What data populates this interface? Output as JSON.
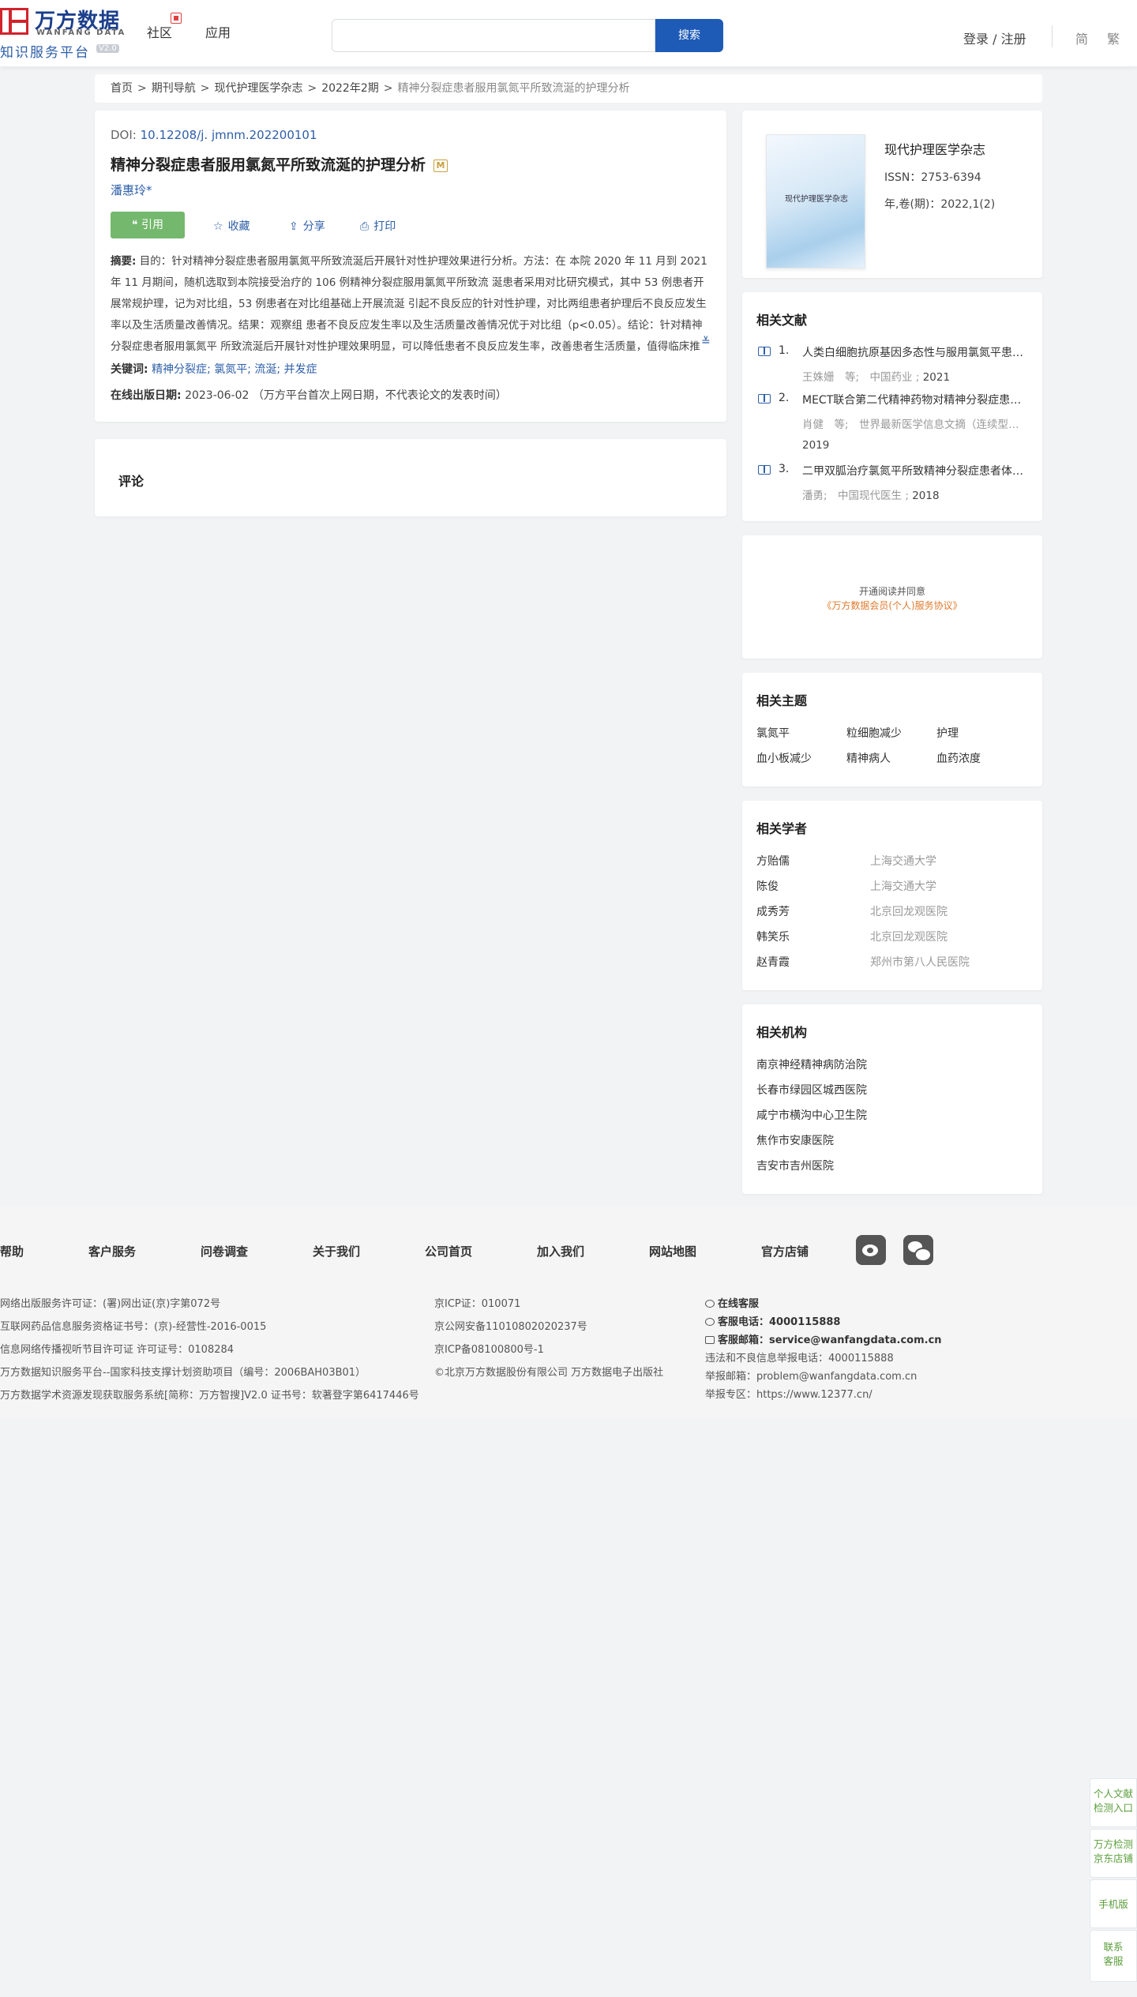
{
  "header": {
    "logo_cn": "万方数据",
    "logo_en": "WANFANG DATA",
    "logo_sub": "知识服务平台",
    "logo_ver": "V2.0",
    "nav": [
      "社区",
      "应用"
    ],
    "search_placeholder": "",
    "search_button": "搜索",
    "login": "登录 / 注册",
    "lang_simplified": "简",
    "lang_traditional": "繁"
  },
  "breadcrumb": [
    "首页",
    "期刊导航",
    "现代护理医学杂志",
    "2022年2期",
    "精神分裂症患者服用氯氮平所致流涎的护理分析"
  ],
  "article": {
    "doi_label": "DOI:",
    "doi": "10.12208/j. jmnm.202200101",
    "title": "精神分裂症患者服用氯氮平所致流涎的护理分析",
    "m_badge": "M",
    "author": "潘惠玲*",
    "actions": {
      "cite": "引用",
      "favorite": "收藏",
      "share": "分享",
      "print": "打印"
    },
    "abstract_label": "摘要:",
    "abstract": "目的：针对精神分裂症患者服用氯氮平所致流涎后开展针对性护理效果进行分析。方法：在 本院 2020 年 11 月到 2021 年 11 月期间，随机选取到本院接受治疗的 106 例精神分裂症服用氯氮平所致流 涎患者采用对比研究模式，其中 53 例患者开展常规护理，记为对比组，53 例患者在对比组基础上开展流涎 引起不良反应的针对性护理，对比两组患者护理后不良反应发生率以及生活质量改善情况。结果：观察组 患者不良反应发生率以及生活质量改善情况优于对比组（p<0.05）。结论：针对精神分裂症患者服用氯氮平 所致流涎后开展针对性护理效果明显，可以降低患者不良反应发生率，改善患者生活质量，值得临床推广。",
    "keywords_label": "关键词:",
    "keywords": [
      "精神分裂症",
      "氯氮平",
      "流涎",
      "并发症"
    ],
    "pubdate_label": "在线出版日期:",
    "pubdate": "2023-06-02",
    "pubdate_note": "（万方平台首次上网日期，不代表论文的发表时间）"
  },
  "comments": {
    "title": "评论"
  },
  "journal": {
    "cover_text": "现代护理医学杂志",
    "name": "现代护理医学杂志",
    "issn": "ISSN：2753-6394",
    "volume": "年,卷(期)：2022,1(2)"
  },
  "related_literature": {
    "title": "相关文献",
    "items": [
      {
        "num": "1.",
        "title": "人类白细胞抗原基因多态性与服用氯氮平患者粒细胞减少的相关性研究",
        "meta": "王姝姗　等;　中国药业 ;",
        "year": "2021"
      },
      {
        "num": "2.",
        "title": "MECT联合第二代精神药物对精神分裂症患者的疗效分析",
        "meta": "肖健　等;　世界最新医学信息文摘（连续型电子期刊）;",
        "year": "2019"
      },
      {
        "num": "3.",
        "title": "二甲双胍治疗氯氮平所致精神分裂症患者体重增加的临床研究",
        "meta": "潘勇;　中国现代医生 ;",
        "year": "2018"
      }
    ]
  },
  "agreement": {
    "line1": "开通阅读并同意",
    "line2": "《万方数据会员(个人)服务协议》"
  },
  "related_topics": {
    "title": "相关主题",
    "items": [
      "氯氮平",
      "粒细胞减少",
      "护理",
      "血小板减少",
      "精神病人",
      "血药浓度"
    ]
  },
  "related_scholars": {
    "title": "相关学者",
    "items": [
      {
        "name": "方贻儒",
        "org": "上海交通大学"
      },
      {
        "name": "陈俊",
        "org": "上海交通大学"
      },
      {
        "name": "成秀芳",
        "org": "北京回龙观医院"
      },
      {
        "name": "韩笑乐",
        "org": "北京回龙观医院"
      },
      {
        "name": "赵青霞",
        "org": "郑州市第八人民医院"
      }
    ]
  },
  "related_orgs": {
    "title": "相关机构",
    "items": [
      "南京神经精神病防治院",
      "长春市绿园区城西医院",
      "咸宁市横沟中心卫生院",
      "焦作市安康医院",
      "吉安市吉州医院"
    ]
  },
  "footer": {
    "links": [
      "帮助",
      "客户服务",
      "问卷调查",
      "关于我们",
      "公司首页",
      "加入我们",
      "网站地图",
      "官方店铺"
    ],
    "col1": [
      "网络出版服务许可证：(署)网出证(京)字第072号",
      "互联网药品信息服务资格证书号：(京)-经营性-2016-0015",
      "信息网络传播视听节目许可证 许可证号：0108284",
      "万方数据知识服务平台--国家科技支撑计划资助项目（编号：2006BAH03B01）",
      "万方数据学术资源发现获取服务系统[简称：万方智搜]V2.0 证书号：软著登字第6417446号"
    ],
    "col2": [
      "京ICP证：010071",
      "京公网安备11010802020237号",
      "京ICP备08100800号-1",
      "©北京万方数据股份有限公司 万方数据电子出版社"
    ],
    "online_service": "在线客服",
    "phone_label": "客服电话：",
    "phone": "4000115888",
    "email_label": "客服邮箱：",
    "email": "service@wanfangdata.com.cn",
    "report_phone": "违法和不良信息举报电话：4000115888",
    "report_email": "举报邮箱：problem@wanfangdata.com.cn",
    "report_site": "举报专区：https://www.12377.cn/"
  },
  "float_bar": {
    "item1_a": "个人文献",
    "item1_b": "检测入口",
    "item2_a": "万方检测",
    "item2_b": "京东店铺",
    "item3": "手机版",
    "item4_a": "联系",
    "item4_b": "客服"
  }
}
